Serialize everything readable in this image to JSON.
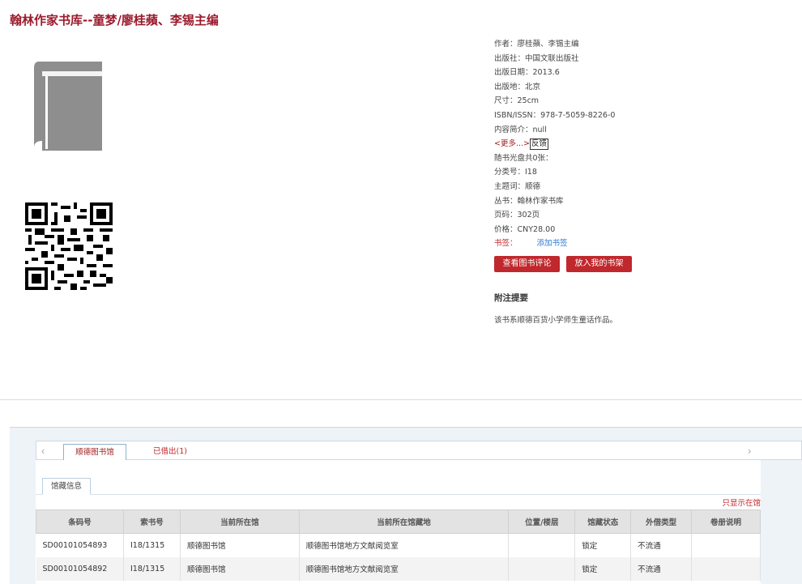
{
  "title": "翰林作家书库--童梦/廖桂蘋、李锡主编",
  "book_info": {
    "author": "作者：廖桂蘋、李锡主编",
    "publisher": "出版社：中国文联出版社",
    "pub_date": "出版日期：2013.6",
    "pub_place": "出版地：北京",
    "size": "尺寸：25cm",
    "isbn": "ISBN/ISSN：978-7-5059-8226-0",
    "summary": "内容简介：null",
    "more_link": "<更多...>",
    "feedback": "反馈",
    "cd_count": "随书光盘共0张：",
    "class_no": "分类号：I18",
    "subject": "主题词：顺德",
    "series": "丛书：翰林作家书库",
    "pages": "页码：302页",
    "price": "价格：CNY28.00",
    "bookmark_label": "书签：",
    "bookmark_add": "添加书签"
  },
  "buttons": {
    "reviews": "查看图书评论",
    "shelf": "放入我的书架"
  },
  "note": {
    "title": "附注提要",
    "text": "该书系顺德百货小学师生童话作品。"
  },
  "tabs": {
    "library": "顺德图书馆",
    "borrowed": "已借出(1)"
  },
  "holdings": {
    "subtab": "馆藏信息",
    "show_all": "只显示在馆",
    "columns": [
      "条码号",
      "索书号",
      "当前所在馆",
      "当前所在馆藏地",
      "位置/楼层",
      "馆藏状态",
      "外借类型",
      "卷册说明"
    ],
    "rows": [
      [
        "SD00101054893",
        "I18/1315",
        "顺德图书馆",
        "顺德图书馆地方文献阅览室",
        "",
        "锁定",
        "不流通",
        ""
      ],
      [
        "SD00101054892",
        "I18/1315",
        "顺德图书馆",
        "顺德图书馆地方文献阅览室",
        "",
        "锁定",
        "不流通",
        ""
      ]
    ]
  },
  "colors": {
    "title": "#9a1b2c",
    "button": "#c0282d",
    "link": "#2a7ad2"
  },
  "icons": {
    "cover": "book-cover-icon",
    "qr": "qr-code"
  }
}
